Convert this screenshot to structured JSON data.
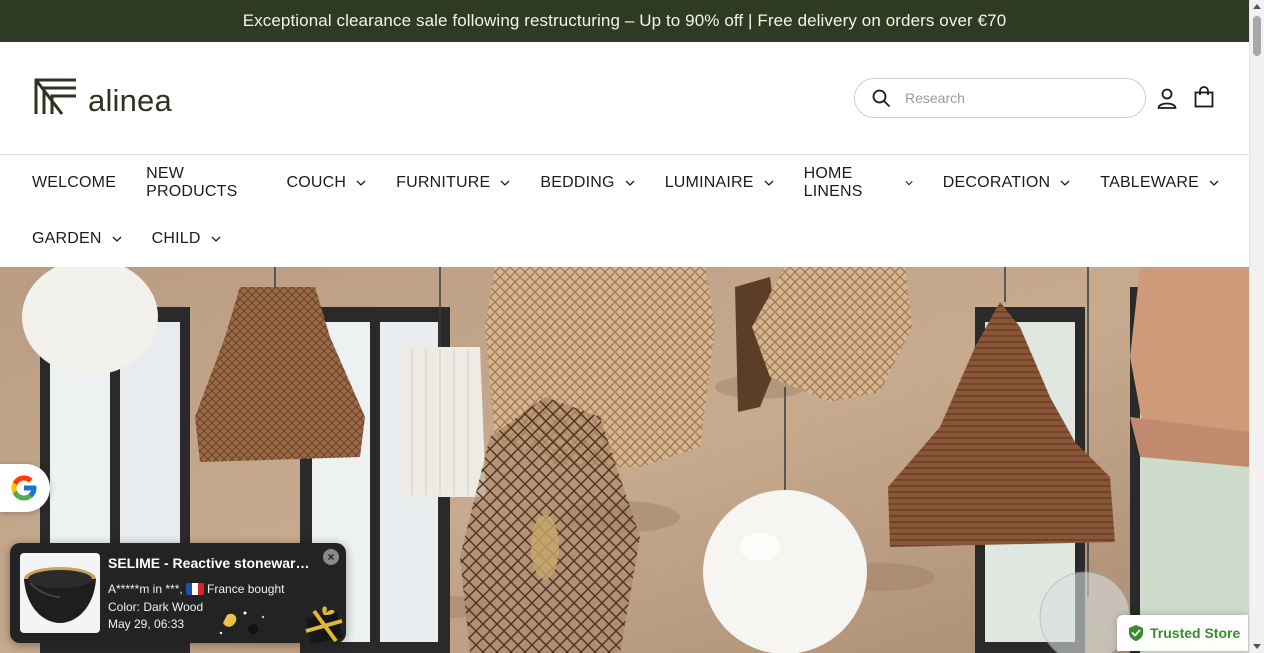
{
  "announcement": "Exceptional clearance sale following restructuring – Up to 90% off | Free delivery on orders over €70",
  "brand": {
    "name": "alinea"
  },
  "search": {
    "placeholder": "Research"
  },
  "nav": {
    "row1": [
      {
        "label": "WELCOME",
        "dropdown": false
      },
      {
        "label": "NEW PRODUCTS",
        "dropdown": false
      },
      {
        "label": "COUCH",
        "dropdown": true
      },
      {
        "label": "FURNITURE",
        "dropdown": true
      },
      {
        "label": "BEDDING",
        "dropdown": true
      },
      {
        "label": "LUMINAIRE",
        "dropdown": true
      },
      {
        "label": "HOME LINENS",
        "dropdown": true
      },
      {
        "label": "DECORATION",
        "dropdown": true
      },
      {
        "label": "TABLEWARE",
        "dropdown": true
      }
    ],
    "row2": [
      {
        "label": "GARDEN",
        "dropdown": true
      },
      {
        "label": "CHILD",
        "dropdown": true
      }
    ]
  },
  "popup": {
    "title": "SELIME - Reactive stoneware bowl",
    "buyer": "A*****m in ***,",
    "country": "France",
    "action": "bought",
    "color_line": "Color: Dark Wood",
    "date": "May 29, 06:33",
    "close": "×"
  },
  "trusted_store": {
    "label": "Trusted Store"
  },
  "colors": {
    "announcement_bg": "#2f3a23",
    "brand": "#2d3520",
    "trusted_green": "#3b8a2f",
    "popup_bg": "#232323"
  }
}
